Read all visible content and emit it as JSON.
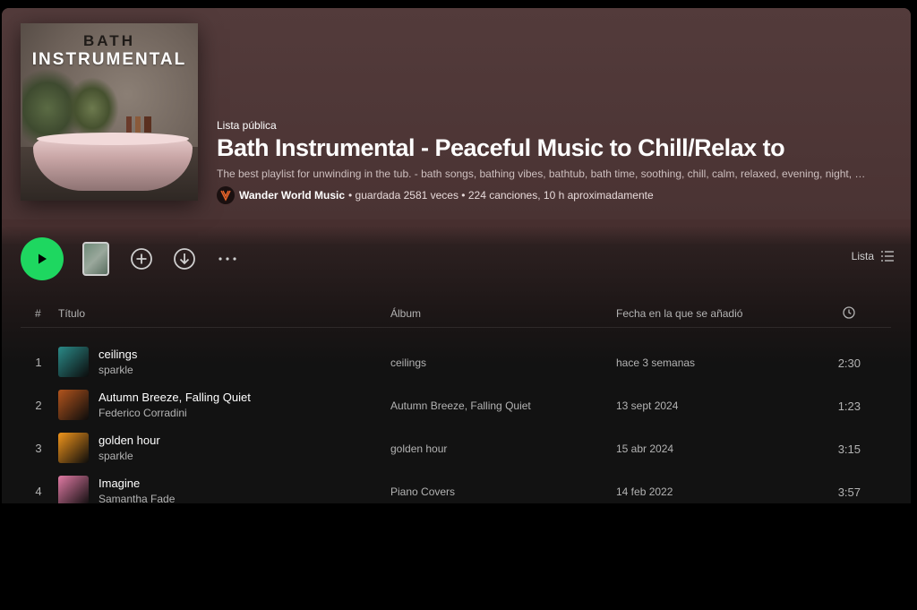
{
  "colors": {
    "accent": "#1ed760",
    "header_bg": "#4f3838",
    "background": "#121212"
  },
  "cover": {
    "line1": "BATH",
    "line2": "INSTRUMENTAL"
  },
  "playlist": {
    "type": "Lista pública",
    "title": "Bath Instrumental - Peaceful Music to Chill/Relax to",
    "description": "The best playlist for unwinding in the tub. - bath songs, bathing vibes, bathtub, bath time, soothing, chill, calm, relaxed, evening, night, spa, self-care",
    "owner": "Wander World Music",
    "stats": "• guardada 2581 veces • 224 canciones, 10 h aproximadamente"
  },
  "controls": {
    "play_icon": "play-icon",
    "add_icon": "plus-circle-icon",
    "download_icon": "download-icon",
    "more_icon": "more-dots-icon",
    "view_label": "Lista",
    "view_icon": "list-view-icon"
  },
  "table": {
    "headers": {
      "num": "#",
      "title": "Título",
      "album": "Álbum",
      "added": "Fecha en la que se añadió",
      "duration_icon": "clock-icon"
    },
    "rows": [
      {
        "num": "1",
        "title": "ceilings",
        "artist": "sparkle",
        "album": "ceilings",
        "added": "hace 3 semanas",
        "duration": "2:30",
        "thumb_color": "#2a8a88"
      },
      {
        "num": "2",
        "title": "Autumn Breeze, Falling Quiet",
        "artist": "Federico Corradini",
        "album": "Autumn Breeze, Falling Quiet",
        "added": "13 sept 2024",
        "duration": "1:23",
        "thumb_color": "#b2541d"
      },
      {
        "num": "3",
        "title": "golden hour",
        "artist": "sparkle",
        "album": "golden hour",
        "added": "15 abr 2024",
        "duration": "3:15",
        "thumb_color": "#f0951c"
      },
      {
        "num": "4",
        "title": "Imagine",
        "artist": "Samantha Fade",
        "album": "Piano Covers",
        "added": "14 feb 2022",
        "duration": "3:57",
        "thumb_color": "#e07aa4"
      }
    ]
  }
}
